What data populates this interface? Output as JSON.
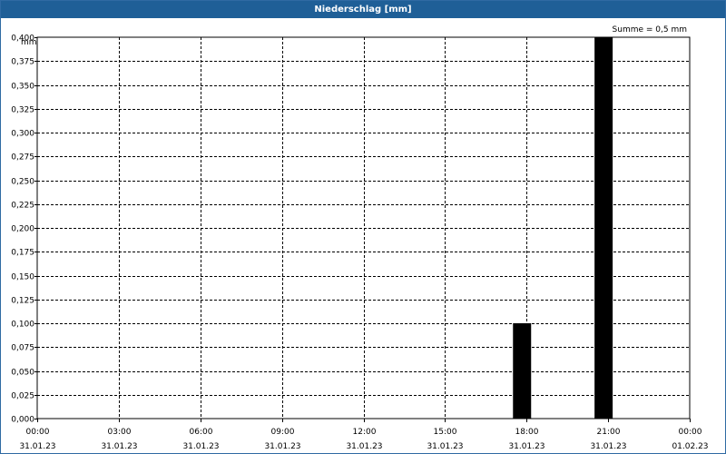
{
  "window": {
    "title": "Niederschlag [mm]"
  },
  "chart_data": {
    "type": "bar",
    "title": "Niederschlag [mm]",
    "ylabel": "mm",
    "summary": "Summe = 0,5 mm",
    "ylim": [
      0,
      0.4
    ],
    "y_ticks": [
      "0,000",
      "0,025",
      "0,050",
      "0,075",
      "0,100",
      "0,125",
      "0,150",
      "0,175",
      "0,200",
      "0,225",
      "0,250",
      "0,275",
      "0,300",
      "0,325",
      "0,350",
      "0,375",
      "0,400"
    ],
    "x_range_hours": [
      0,
      24
    ],
    "x_ticks": [
      {
        "time": "00:00",
        "date": "31.01.23"
      },
      {
        "time": "03:00",
        "date": "31.01.23"
      },
      {
        "time": "06:00",
        "date": "31.01.23"
      },
      {
        "time": "09:00",
        "date": "31.01.23"
      },
      {
        "time": "12:00",
        "date": "31.01.23"
      },
      {
        "time": "15:00",
        "date": "31.01.23"
      },
      {
        "time": "18:00",
        "date": "31.01.23"
      },
      {
        "time": "21:00",
        "date": "31.01.23"
      },
      {
        "time": "00:00",
        "date": "01.02.23"
      }
    ],
    "bars": [
      {
        "start": "17:30",
        "end": "18:10",
        "value": 0.1
      },
      {
        "start": "20:30",
        "end": "21:10",
        "value": 0.4
      }
    ],
    "bar_color": "#000000",
    "grid": true
  }
}
